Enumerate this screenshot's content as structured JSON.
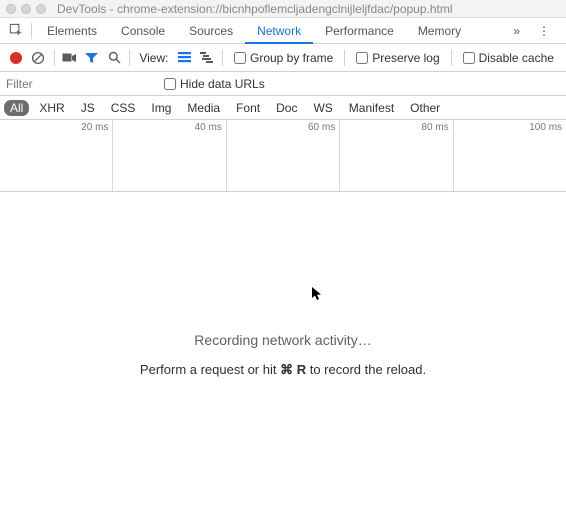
{
  "window": {
    "title": "DevTools - chrome-extension://bicnhpoflemcljadengclnijleljfdac/popup.html"
  },
  "tabs": {
    "items": [
      "Elements",
      "Console",
      "Sources",
      "Network",
      "Performance",
      "Memory"
    ],
    "active": "Network",
    "overflow_glyph": "»"
  },
  "toolbar": {
    "view_label": "View:",
    "group_by_frame": "Group by frame",
    "preserve_log": "Preserve log",
    "disable_cache": "Disable cache"
  },
  "filter": {
    "placeholder": "Filter",
    "hide_data_urls": "Hide data URLs"
  },
  "types": {
    "items": [
      "All",
      "XHR",
      "JS",
      "CSS",
      "Img",
      "Media",
      "Font",
      "Doc",
      "WS",
      "Manifest",
      "Other"
    ],
    "active": "All"
  },
  "timeline": {
    "ticks": [
      "20 ms",
      "40 ms",
      "60 ms",
      "80 ms",
      "100 ms"
    ]
  },
  "empty": {
    "headline": "Recording network activity…",
    "sub_prefix": "Perform a request or hit ",
    "sub_key1": "⌘",
    "sub_key2": "R",
    "sub_suffix": " to record the reload."
  }
}
